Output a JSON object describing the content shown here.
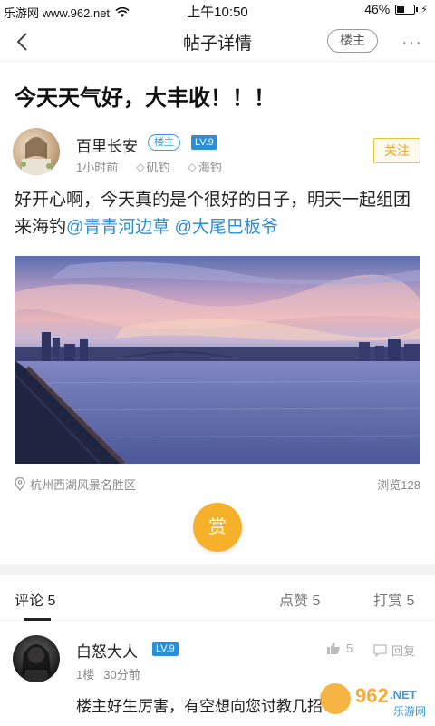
{
  "status_bar": {
    "carrier": "乐游网 www.962.net",
    "time": "上午10:50",
    "battery": "46%",
    "battery_level": 0.46
  },
  "nav": {
    "title": "帖子详情",
    "lz_label": "楼主",
    "more_label": "···"
  },
  "post": {
    "title": "今天天气好，大丰收！！！",
    "author": {
      "name": "百里长安",
      "badge_lz": "楼主",
      "level": "LV.9",
      "time": "1小时前",
      "tags": [
        "矶钓",
        "海钓"
      ],
      "follow_label": "关注"
    },
    "body_text": "好开心啊，今天真的是个很好的日子，明天一起组团来海钓",
    "mentions": [
      "@青青河边草",
      "@大尾巴板爷"
    ],
    "location": "杭州西湖风景名胜区",
    "views": "浏览128",
    "reward_label": "赏"
  },
  "tabs": [
    {
      "label": "评论 5",
      "active": true
    },
    {
      "label": "点赞 5",
      "active": false
    },
    {
      "label": "打赏 5",
      "active": false
    }
  ],
  "comments": [
    {
      "name": "白怒大人",
      "level": "LV.9",
      "floor": "1楼",
      "time": "30分前",
      "likes": "5",
      "reply_label": "回复",
      "text": "楼主好生厉害，有空想向您讨教几招"
    }
  ],
  "watermark": {
    "brand": "962",
    "suffix": ".NET",
    "sub": "乐游网"
  },
  "colors": {
    "accent_blue": "#2b8fd6",
    "reward_yellow": "#f6b12b",
    "follow_orange": "#f0a020"
  }
}
